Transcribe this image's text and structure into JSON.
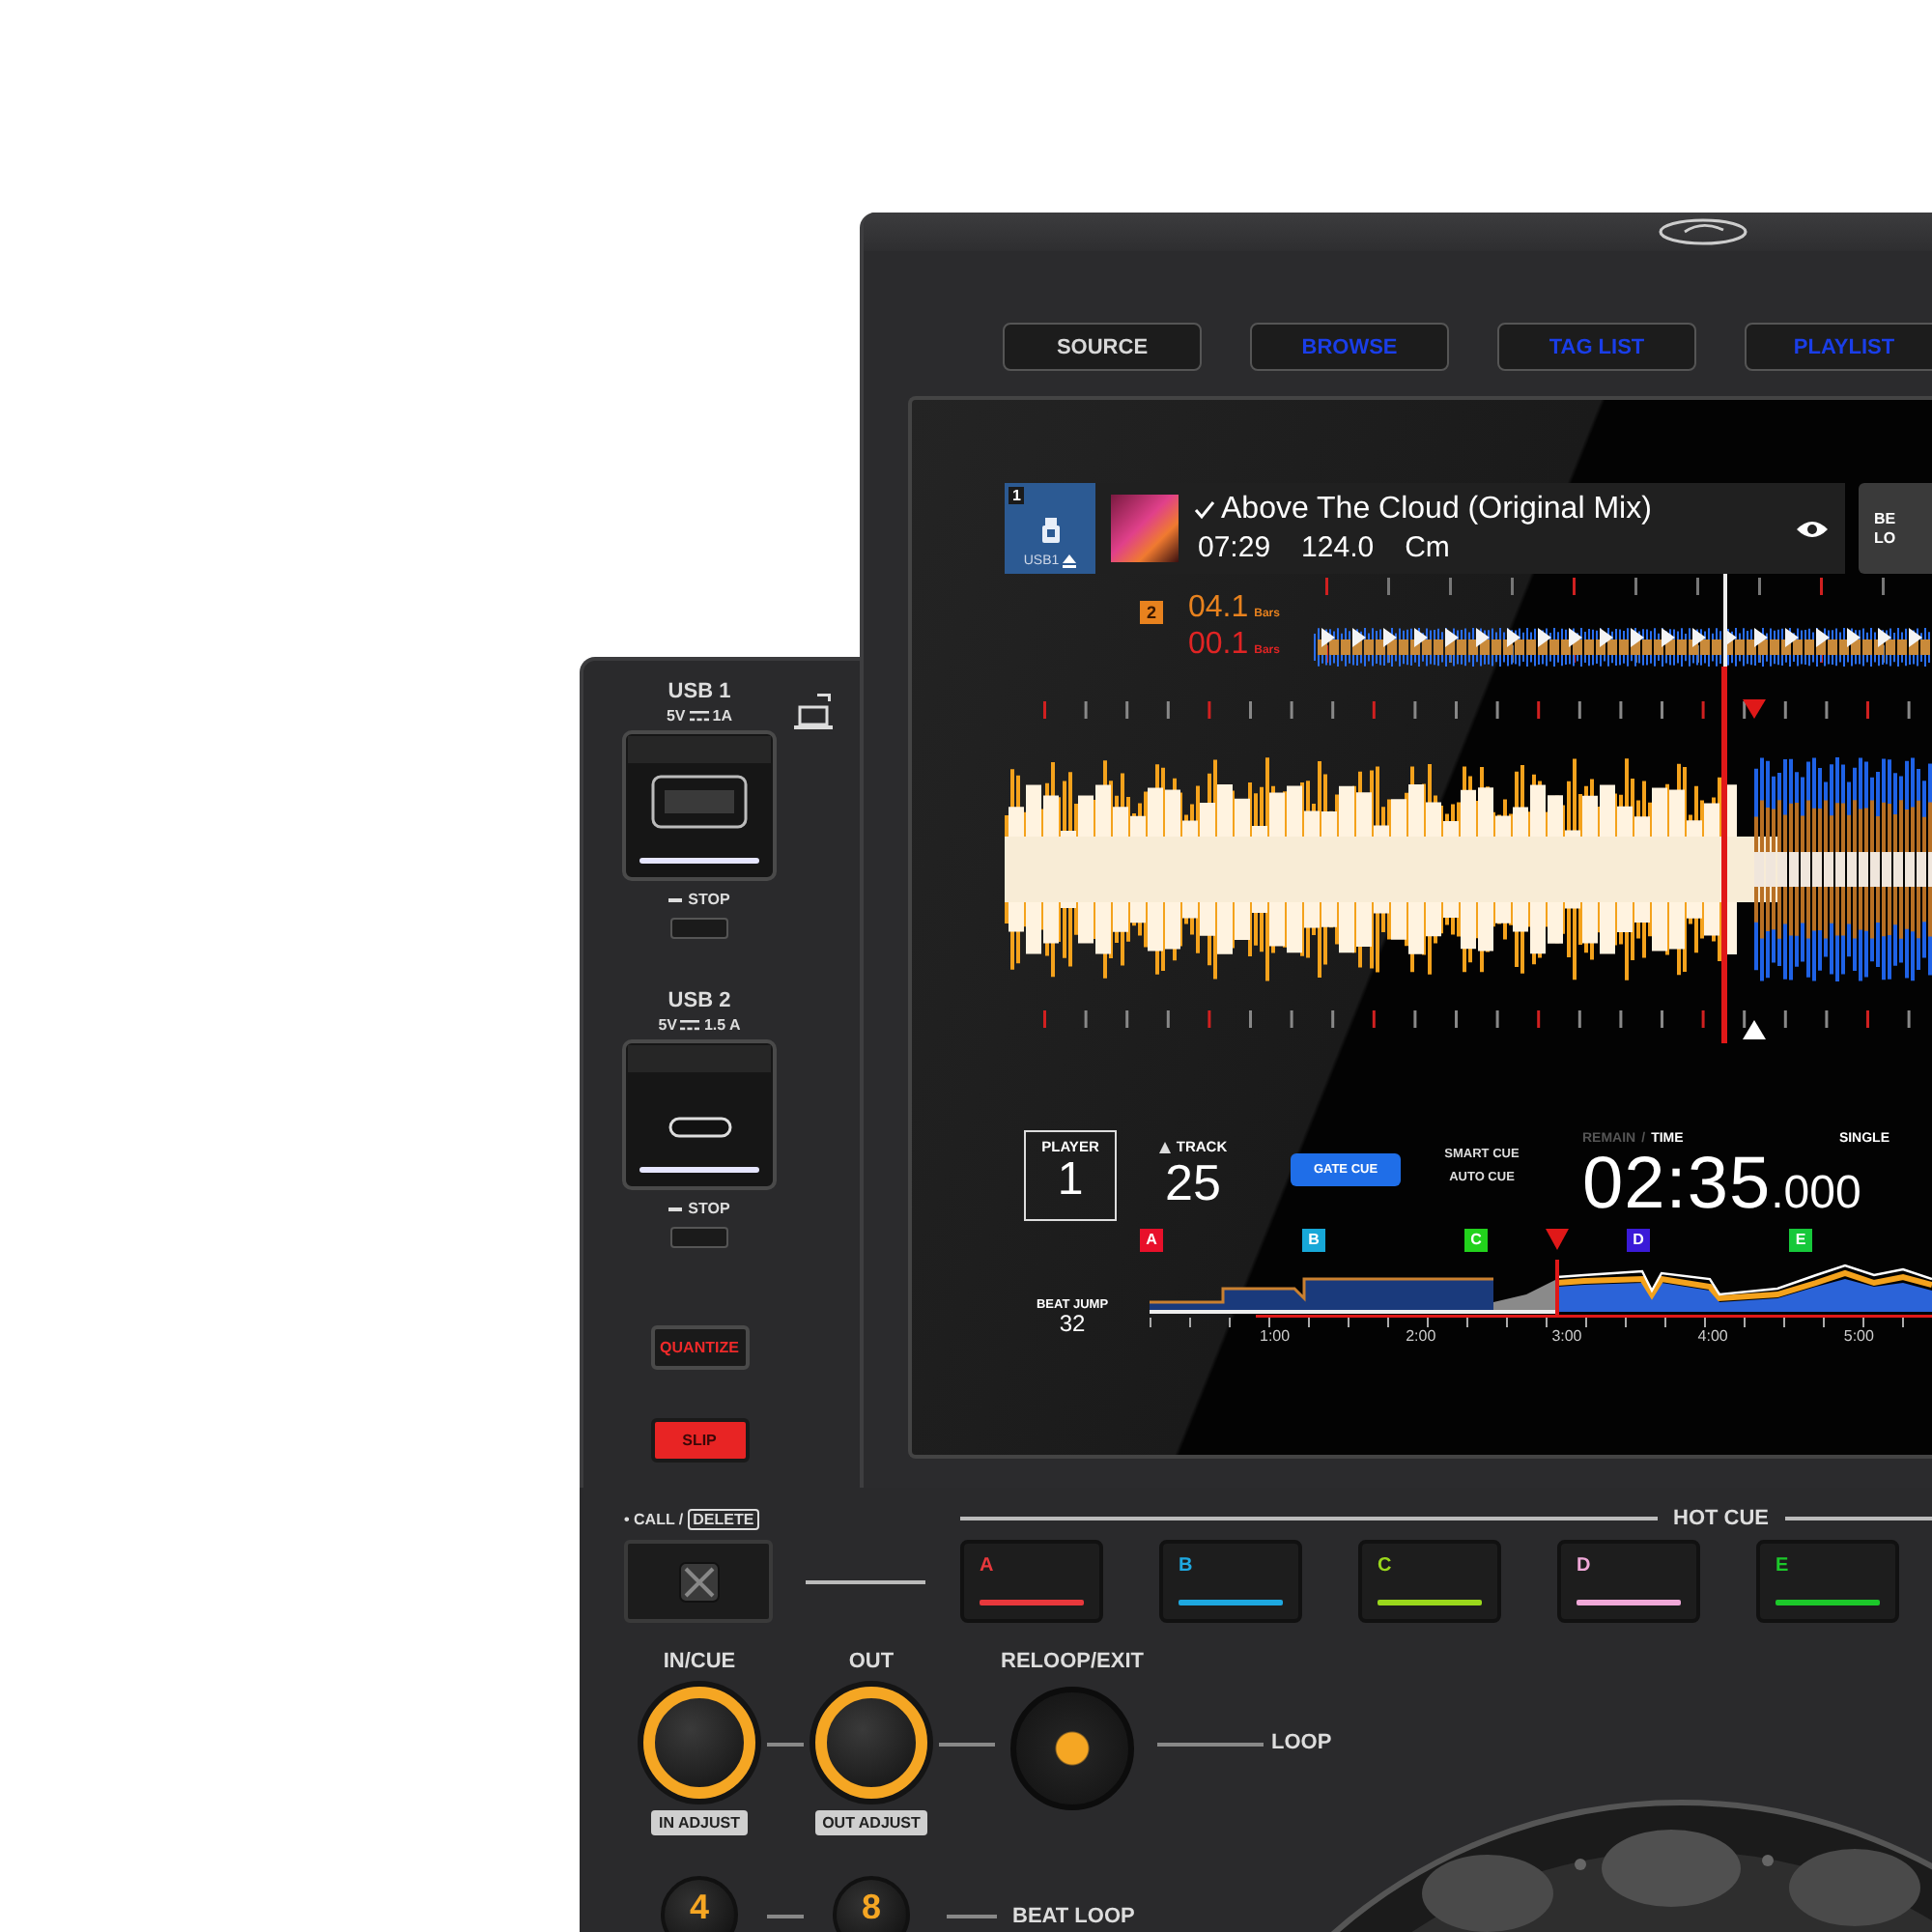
{
  "top_buttons": [
    {
      "label": "SOURCE",
      "color": "#d8d8d8"
    },
    {
      "label": "BROWSE",
      "color": "#1a3ee8"
    },
    {
      "label": "TAG LIST",
      "color": "#1a3ee8"
    },
    {
      "label": "PLAYLIST",
      "color": "#1a3ee8"
    }
  ],
  "display": {
    "header": {
      "deck": "1",
      "source": "USB1",
      "title": "Above The Cloud (Original Mix)",
      "length": "07:29",
      "bpm": "124.0",
      "key": "Cm",
      "side_box": [
        "BE",
        "LO"
      ]
    },
    "loop_info": {
      "badge": "2",
      "readings": [
        {
          "value": "04.1",
          "unit": "Bars",
          "color": "#e8821e"
        },
        {
          "value": "00.1",
          "unit": "Bars",
          "color": "#e02424"
        }
      ]
    },
    "player": {
      "label": "PLAYER",
      "number": "1"
    },
    "track": {
      "label": "TRACK",
      "number": "25"
    },
    "cue_modes": [
      {
        "label": "GATE CUE",
        "selected": true
      },
      {
        "label": "SMART CUE",
        "selected": false
      },
      {
        "label": "AUTO CUE",
        "selected": false
      }
    ],
    "time_modes": [
      {
        "label": "REMAIN",
        "selected": false
      },
      {
        "label": "TIME",
        "selected": true
      }
    ],
    "time_separator": "/",
    "time": {
      "main": "02:35",
      "fraction": ".000"
    },
    "play_mode": "SINGLE",
    "hot_cue_markers": [
      {
        "label": "A",
        "color": "#e8102a"
      },
      {
        "label": "B",
        "color": "#17a8d8"
      },
      {
        "label": "C",
        "color": "#22d21c"
      },
      {
        "label": "D",
        "color": "#3a1ad8"
      },
      {
        "label": "E",
        "color": "#16c83a"
      }
    ],
    "beat_jump": {
      "label": "BEAT JUMP",
      "value": "32"
    },
    "timeline": [
      "1:00",
      "2:00",
      "3:00",
      "4:00",
      "5:00"
    ]
  },
  "left_panel": {
    "usb_ports": [
      {
        "label": "USB 1",
        "voltage": "5V",
        "current": "1A",
        "kind": "type-a",
        "stop_label": "STOP"
      },
      {
        "label": "USB 2",
        "voltage": "5V",
        "current": "1.5 A",
        "kind": "type-c",
        "stop_label": "STOP"
      }
    ],
    "buttons": [
      {
        "label": "QUANTIZE",
        "kind": "outline"
      },
      {
        "label": "SLIP",
        "kind": "filled"
      }
    ]
  },
  "bottom": {
    "call_label": "• CALL /",
    "delete_label": "DELETE",
    "hot_cue_label": "HOT CUE",
    "pads": [
      {
        "label": "A",
        "color": "#e8383c"
      },
      {
        "label": "B",
        "color": "#1ea8e0"
      },
      {
        "label": "C",
        "color": "#9ad81c"
      },
      {
        "label": "D",
        "color": "#f0a8d8"
      },
      {
        "label": "E",
        "color": "#1cc82a"
      }
    ],
    "loop_buttons": [
      {
        "label": "IN/CUE",
        "kind": "ring",
        "tag": "IN ADJUST"
      },
      {
        "label": "OUT",
        "kind": "ring",
        "tag": "OUT ADJUST"
      },
      {
        "label": "RELOOP/EXIT",
        "kind": "dot"
      }
    ],
    "loop_label": "LOOP",
    "beat_loop_buttons": [
      "4",
      "8"
    ],
    "beat_loop_label": "BEAT LOOP"
  }
}
